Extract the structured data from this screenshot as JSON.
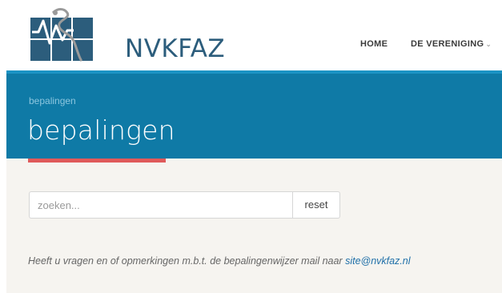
{
  "brand": {
    "name": "NVKFAZ"
  },
  "nav": {
    "items": [
      {
        "label": "HOME"
      },
      {
        "label": "DE VERENIGING"
      }
    ]
  },
  "hero": {
    "breadcrumb": "bepalingen",
    "title": "bepalingen"
  },
  "search": {
    "placeholder": "zoeken...",
    "reset_label": "reset"
  },
  "note": {
    "text": "Heeft u vragen en of opmerkingen m.b.t. de bepalingenwijzer mail naar ",
    "email": "site@nvkfaz.nl"
  },
  "colors": {
    "header_bg": "#0f7aa6",
    "accent": "#e05a5a",
    "content_bg": "#f6f4f0",
    "brand_text": "#2c5d7c"
  }
}
